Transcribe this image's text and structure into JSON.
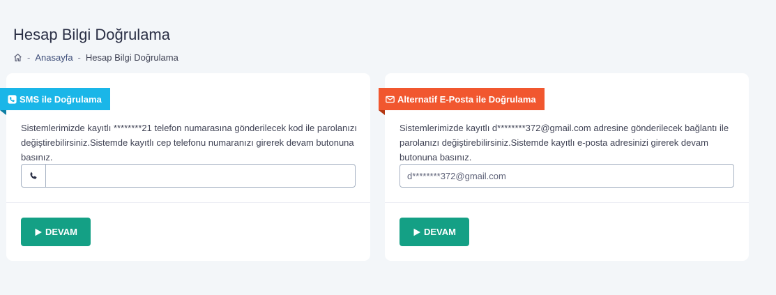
{
  "page": {
    "title": "Hesap Bilgi Doğrulama"
  },
  "breadcrumb": {
    "home_icon": "home-icon",
    "separator": "-",
    "items": [
      "Anasayfa",
      "Hesap Bilgi Doğrulama"
    ]
  },
  "sms_card": {
    "ribbon_label": "SMS ile Doğrulama",
    "ribbon_icon": "phone-square-icon",
    "ribbon_color": "#1ab6e8",
    "description": "Sistemlerimizde kayıtlı ********21 telefon numarasına gönderilecek kod ile parolanızı değiştirebilirsiniz.Sistemde kayıtlı cep telefonu numaranızı girerek devam butonuna basınız.",
    "input_icon": "phone-icon",
    "input_value": "",
    "input_placeholder": "",
    "button_label": "DEVAM",
    "button_icon": "play-icon"
  },
  "email_card": {
    "ribbon_label": "Alternatif E-Posta ile Doğrulama",
    "ribbon_icon": "envelope-icon",
    "ribbon_color": "#f1572f",
    "description": "Sistemlerimizde kayıtlı d********372@gmail.com adresine gönderilecek bağlantı ile parolanızı değiştirebilirsiniz.Sistemde kayıtlı e-posta adresinizi girerek devam butonuna basınız.",
    "input_value": "",
    "input_placeholder": "d********372@gmail.com",
    "button_label": "DEVAM",
    "button_icon": "play-icon"
  },
  "colors": {
    "button": "#14a085",
    "background": "#f3f6f9"
  }
}
